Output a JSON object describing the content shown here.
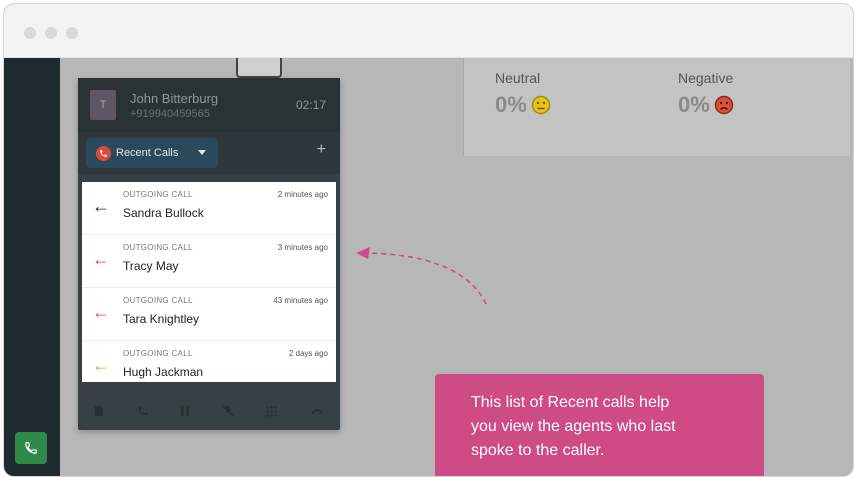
{
  "sentiment": {
    "neutral": {
      "label": "Neutral",
      "value": "0%"
    },
    "negative": {
      "label": "Negative",
      "value": "0%"
    }
  },
  "caller": {
    "avatar_initial": "T",
    "name": "John Bitterburg",
    "number": "+919940459565",
    "timer": "02:17"
  },
  "tabs": {
    "recent_label": "Recent Calls",
    "add_label": "+"
  },
  "recent_calls": [
    {
      "type": "OUTGOING CALL",
      "time": "2 minutes ago",
      "name": "Sandra Bullock",
      "arrow_color": "#222222"
    },
    {
      "type": "OUTGOING CALL",
      "time": "3 minutes ago",
      "name": "Tracy May",
      "arrow_color": "#e0455a"
    },
    {
      "type": "OUTGOING CALL",
      "time": "43 minutes ago",
      "name": "Tara Knightley",
      "arrow_color": "#e0455a"
    },
    {
      "type": "OUTGOING CALL",
      "time": "2 days ago",
      "name": "Hugh Jackman",
      "arrow_color": "#6fcf4a"
    }
  ],
  "controls": [
    "notes-icon",
    "transfer-icon",
    "pause-icon",
    "mute-icon",
    "keypad-icon",
    "hangup-icon"
  ],
  "callout": {
    "lines": [
      "This list of Recent calls help",
      "you view the agents who last",
      "spoke to the caller."
    ]
  },
  "colors": {
    "callout_bg": "#cf4b86",
    "sidebar_bg": "#1e2a2e",
    "phone_green": "#2f8a4a",
    "recent_badge_red": "#d94a3d"
  }
}
